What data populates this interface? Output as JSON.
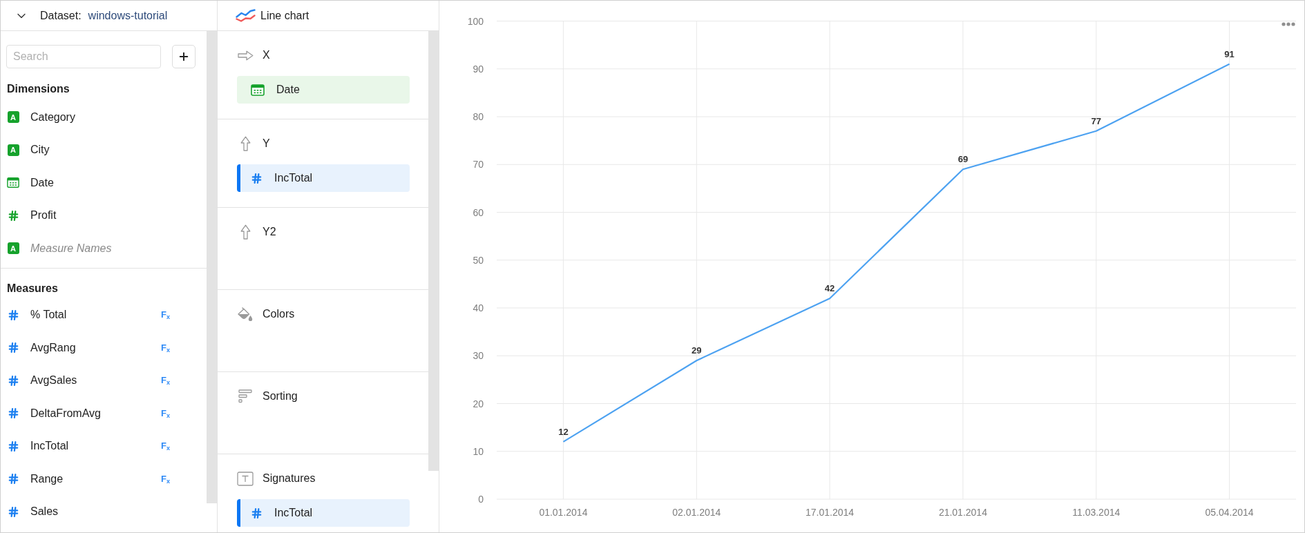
{
  "dataset": {
    "label": "Dataset:",
    "name": "windows-tutorial"
  },
  "search": {
    "placeholder": "Search"
  },
  "dimensions": {
    "title": "Dimensions",
    "items": [
      {
        "name": "Category",
        "kind": "string",
        "type_mark": "A",
        "pseudo": false
      },
      {
        "name": "City",
        "kind": "string",
        "type_mark": "A",
        "pseudo": false
      },
      {
        "name": "Date",
        "kind": "date",
        "pseudo": false
      },
      {
        "name": "Profit",
        "kind": "number",
        "pseudo": false
      },
      {
        "name": "Measure Names",
        "kind": "string",
        "type_mark": "A",
        "pseudo": true
      }
    ]
  },
  "measures": {
    "title": "Measures",
    "items": [
      {
        "name": "% Total",
        "kind": "number",
        "formula_mark": "F$_{x}$"
      },
      {
        "name": "AvgRang",
        "kind": "number",
        "formula_mark": "F$_{x}$"
      },
      {
        "name": "AvgSales",
        "kind": "number",
        "formula_mark": "F$_{x}$"
      },
      {
        "name": "DeltaFromAvg",
        "kind": "number",
        "formula_mark": "F$_{x}$"
      },
      {
        "name": "IncTotal",
        "kind": "number",
        "formula_mark": "F$_{x}$"
      },
      {
        "name": "Range",
        "kind": "number",
        "formula_mark": "F$_{x}$"
      },
      {
        "name": "Sales",
        "kind": "number"
      }
    ]
  },
  "chart_type": {
    "label": "Line chart"
  },
  "sections": [
    {
      "title": "X",
      "kind": "x",
      "fields": [
        {
          "name": "Date",
          "kind": "date"
        }
      ]
    },
    {
      "title": "Y",
      "kind": "y",
      "fields": [
        {
          "name": "IncTotal",
          "kind": "number"
        }
      ]
    },
    {
      "title": "Y2",
      "kind": "y"
    },
    {
      "title": "Colors",
      "kind": "colors"
    },
    {
      "title": "Sorting",
      "kind": "sorting"
    },
    {
      "title": "Signatures",
      "kind": "signatures",
      "fields": [
        {
          "name": "IncTotal",
          "kind": "number"
        }
      ]
    }
  ],
  "chart": {
    "chart_data": {
      "type": "line",
      "categories": [
        "01.01.2014",
        "02.01.2014",
        "17.01.2014",
        "21.01.2014",
        "11.03.2014",
        "05.04.2014"
      ],
      "series": [
        {
          "color": "#4da2f1",
          "values": [
            12,
            29,
            42,
            69,
            77,
            91
          ]
        }
      ],
      "ylim": [
        0,
        100
      ],
      "yticks": [
        0,
        10,
        20,
        30,
        40,
        50,
        60,
        70,
        80,
        90,
        100
      ],
      "grid": true,
      "data_labels": true
    }
  }
}
